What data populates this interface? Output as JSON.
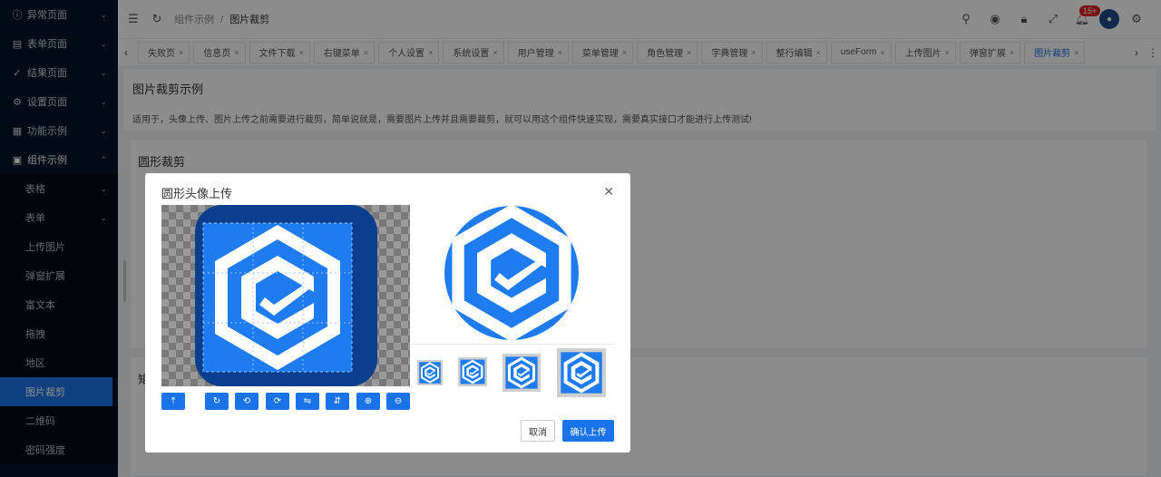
{
  "sidebar": {
    "items": [
      {
        "label": "异常页面",
        "icon": "exclamation-circle-icon",
        "glyph": "ⓘ"
      },
      {
        "label": "表单页面",
        "icon": "form-icon",
        "glyph": "▤"
      },
      {
        "label": "结果页面",
        "icon": "check-circle-icon",
        "glyph": "✓"
      },
      {
        "label": "设置页面",
        "icon": "gear-icon",
        "glyph": "⚙"
      },
      {
        "label": "功能示例",
        "icon": "function-icon",
        "glyph": "▦"
      },
      {
        "label": "组件示例",
        "icon": "component-icon",
        "glyph": "▣"
      }
    ],
    "sub_items": [
      {
        "label": "表格",
        "has_children": true
      },
      {
        "label": "表单",
        "has_children": true
      },
      {
        "label": "上传图片",
        "has_children": false
      },
      {
        "label": "弹窗扩展",
        "has_children": false
      },
      {
        "label": "富文本",
        "has_children": false
      },
      {
        "label": "拖拽",
        "has_children": false
      },
      {
        "label": "地区",
        "has_children": false
      },
      {
        "label": "图片裁剪",
        "has_children": false
      },
      {
        "label": "二维码",
        "has_children": false
      },
      {
        "label": "密码强度",
        "has_children": false
      }
    ],
    "active_sub": "图片裁剪"
  },
  "header": {
    "breadcrumb_parent": "组件示例",
    "breadcrumb_sep": "/",
    "breadcrumb_current": "图片裁剪",
    "notification_badge": "15+"
  },
  "tabs": [
    {
      "label": "失败页",
      "active": false
    },
    {
      "label": "信息页",
      "active": false
    },
    {
      "label": "文件下载",
      "active": false
    },
    {
      "label": "右键菜单",
      "active": false
    },
    {
      "label": "个人设置",
      "active": false
    },
    {
      "label": "系统设置",
      "active": false
    },
    {
      "label": "用户管理",
      "active": false
    },
    {
      "label": "菜单管理",
      "active": false
    },
    {
      "label": "角色管理",
      "active": false
    },
    {
      "label": "字典管理",
      "active": false
    },
    {
      "label": "整行编辑",
      "active": false
    },
    {
      "label": "useForm",
      "active": false
    },
    {
      "label": "上传图片",
      "active": false
    },
    {
      "label": "弹窗扩展",
      "active": false
    },
    {
      "label": "图片裁剪",
      "active": true
    }
  ],
  "page": {
    "title": "图片裁剪示例",
    "description": "适用于，头像上传、图片上传之前需要进行裁剪，简单说就是，需要图片上传并且需要裁剪，就可以用这个组件快速实现，需要真实接口才能进行上传测试!",
    "card_title": "圆形裁剪",
    "card2_title": "矩"
  },
  "modal": {
    "title": "圆形头像上传",
    "cancel_label": "取消",
    "confirm_label": "确认上传",
    "toolbar_icons": [
      "upload-icon",
      "reset-icon",
      "rotate-left-icon",
      "rotate-right-icon",
      "flip-horizontal-icon",
      "flip-vertical-icon",
      "zoom-in-icon",
      "zoom-out-icon"
    ],
    "toolbar_glyphs": [
      "⤒",
      "↻",
      "⟲",
      "⟳",
      "⇋",
      "⇵",
      "⊕",
      "⊖"
    ]
  },
  "colors": {
    "sidebar_bg": "#001529",
    "accent": "#1a73e8",
    "logo_blue": "#1e7cf0",
    "logo_dark": "#0a3f8f"
  }
}
